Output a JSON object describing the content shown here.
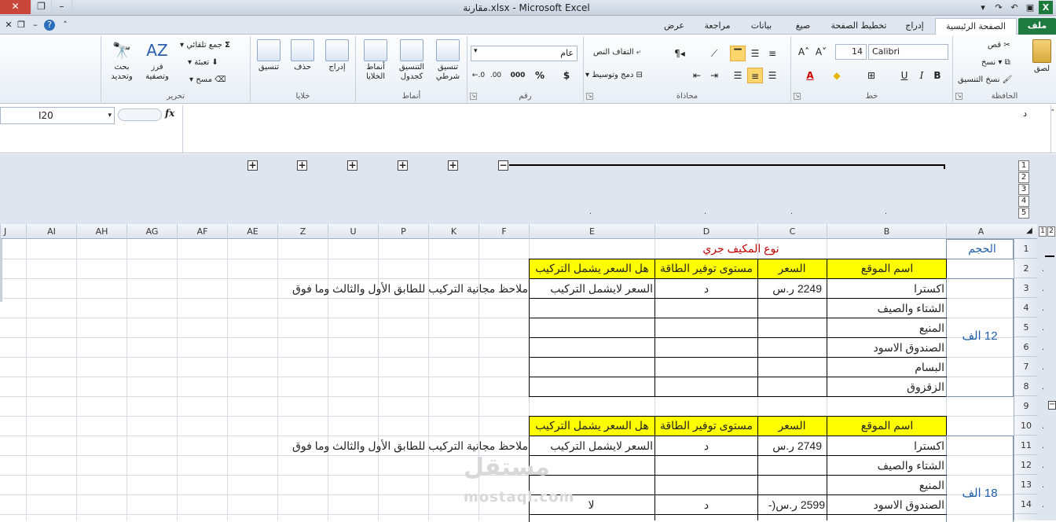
{
  "window": {
    "title": "مقارنة.xlsx - Microsoft Excel"
  },
  "tabs": [
    {
      "label": "ملف"
    },
    {
      "label": "الصفحة الرئيسية"
    },
    {
      "label": "إدراج"
    },
    {
      "label": "تخطيط الصفحة"
    },
    {
      "label": "صيغ"
    },
    {
      "label": "بيانات"
    },
    {
      "label": "مراجعة"
    },
    {
      "label": "عرض"
    }
  ],
  "ribbon": {
    "clipboard": {
      "group": "الحافظة",
      "paste": "لصق",
      "cut": "قص",
      "copy": "نسخ",
      "format_painter": "نسخ التنسيق"
    },
    "font": {
      "group": "خط",
      "font_name": "Calibri",
      "font_size": "14",
      "bold": "B",
      "italic": "I",
      "underline": "U"
    },
    "alignment": {
      "group": "محاذاة",
      "wrap": "التفاف النص",
      "merge": "دمج وتوسيط"
    },
    "number": {
      "group": "رقم",
      "format": "عام",
      "currency": "$",
      "percent": "%",
      "comma": "000"
    },
    "styles": {
      "group": "أنماط",
      "conditional": "تنسيق شرطي",
      "table": "التنسيق كجدول",
      "cell": "أنماط الخلايا"
    },
    "cells": {
      "group": "خلايا",
      "insert": "إدراج",
      "delete": "حذف",
      "format": "تنسيق"
    },
    "editing": {
      "group": "تحرير",
      "autosum": "جمع تلقائي",
      "fill": "تعبئة",
      "clear": "مسح",
      "sort": "فرز وتصفية",
      "find": "بحث وتحديد"
    }
  },
  "formula_bar": {
    "name_box": "I20",
    "fx": "fx",
    "content": "د"
  },
  "outline": {
    "levels": [
      "1",
      "2",
      "3",
      "4",
      "5"
    ],
    "col_levels": [
      "1",
      "2"
    ]
  },
  "columns": [
    "A",
    "B",
    "C",
    "D",
    "E",
    "F",
    "K",
    "P",
    "U",
    "Z",
    "AE",
    "AF",
    "AG",
    "AH",
    "AI",
    "J"
  ],
  "rows": [
    "1",
    "2",
    "3",
    "4",
    "5",
    "6",
    "7",
    "8",
    "9",
    "10",
    "11",
    "12",
    "13",
    "14"
  ],
  "sheet": {
    "a1": "الحجم",
    "title_unit": "نوع المكيف جري",
    "table1": {
      "headers": {
        "site": "اسم الموقع",
        "price": "السعر",
        "energy": "مستوى توفير الطاقة",
        "install": "هل السعر يشمل التركيب"
      },
      "size": "12 الف",
      "rows": [
        {
          "site": "اكسترا",
          "price": "2249 ر.س",
          "energy": "د",
          "install": "السعر لايشمل التركيب",
          "note": "ملاحظ مجانية التركيب للطابق الأول والثالث وما فوق"
        },
        {
          "site": "الشتاء والصيف",
          "price": "",
          "energy": "",
          "install": "",
          "note": ""
        },
        {
          "site": "المنيع",
          "price": "",
          "energy": "",
          "install": "",
          "note": ""
        },
        {
          "site": "الصندوق الاسود",
          "price": "",
          "energy": "",
          "install": "",
          "note": ""
        },
        {
          "site": "البسام",
          "price": "",
          "energy": "",
          "install": "",
          "note": ""
        },
        {
          "site": "الزقزوق",
          "price": "",
          "energy": "",
          "install": "",
          "note": ""
        }
      ]
    },
    "table2": {
      "headers": {
        "site": "اسم الموقع",
        "price": "السعر",
        "energy": "مستوى توفير الطاقة",
        "install": "هل السعر يشمل التركيب"
      },
      "size": "18 الف",
      "rows": [
        {
          "site": "اكسترا",
          "price": "2749 ر.س",
          "energy": "د",
          "install": "السعر لايشمل التركيب",
          "note": "ملاحظ مجانية التركيب للطابق الأول والثالث وما فوق"
        },
        {
          "site": "الشتاء والصيف",
          "price": "",
          "energy": "",
          "install": "",
          "note": ""
        },
        {
          "site": "المنيع",
          "price": "",
          "energy": "",
          "install": "",
          "note": ""
        },
        {
          "site": "الصندوق الاسود",
          "price": "2599 ر.س(-",
          "energy": "د",
          "install": "لا",
          "note": ""
        }
      ]
    }
  },
  "watermark": {
    "arabic": "مستقل",
    "latin": "mostaql.com"
  },
  "colors": {
    "file_tab": "#1f7a3f",
    "highlight": "#ffff00",
    "title_red": "#c00000",
    "size_blue": "#1f5fa8"
  }
}
